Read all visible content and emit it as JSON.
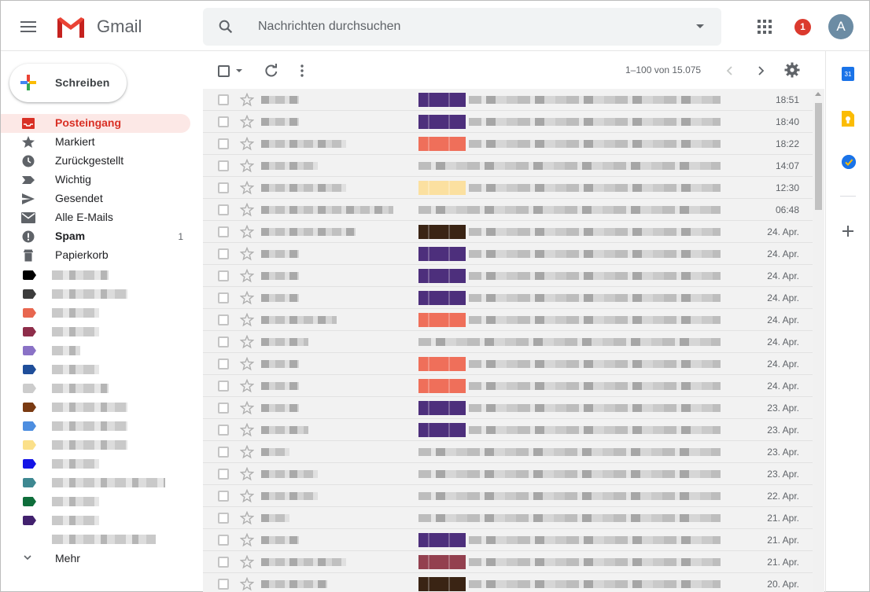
{
  "app": {
    "name": "Gmail"
  },
  "search": {
    "placeholder": "Nachrichten durchsuchen"
  },
  "header": {
    "notification_count": "1",
    "avatar_letter": "A"
  },
  "compose": {
    "label": "Schreiben"
  },
  "sidebar": {
    "items": [
      {
        "label": "Posteingang",
        "icon": "inbox-icon",
        "active": true
      },
      {
        "label": "Markiert",
        "icon": "star-icon"
      },
      {
        "label": "Zurückgestellt",
        "icon": "clock-icon"
      },
      {
        "label": "Wichtig",
        "icon": "important-icon"
      },
      {
        "label": "Gesendet",
        "icon": "send-icon"
      },
      {
        "label": "Alle E-Mails",
        "icon": "mail-icon"
      },
      {
        "label": "Spam",
        "icon": "spam-icon",
        "bold": true,
        "count": "1"
      },
      {
        "label": "Papierkorb",
        "icon": "trash-icon"
      }
    ],
    "label_colors": [
      "#000000",
      "#3c3c3c",
      "#e8664f",
      "#8e2d4a",
      "#8a72c6",
      "#1f4e9a",
      "#cccccc",
      "#7a3a12",
      "#4d8ee0",
      "#fbe08a",
      "#1414e6",
      "#3e8891",
      "#0f6e3b",
      "#42216e",
      "#ffffff"
    ],
    "more_label": "Mehr"
  },
  "toolbar": {
    "pager": "1–100 von 15.075"
  },
  "emails": [
    {
      "date": "18:51",
      "thumb": "#4d2f7c"
    },
    {
      "date": "18:40",
      "thumb": "#4d2f7c"
    },
    {
      "date": "18:22",
      "thumb": "#ef6f5a"
    },
    {
      "date": "14:07",
      "thumb": ""
    },
    {
      "date": "12:30",
      "thumb": "#fbe0a0"
    },
    {
      "date": "06:48",
      "thumb": ""
    },
    {
      "date": "24. Apr.",
      "thumb": "#3a2414"
    },
    {
      "date": "24. Apr.",
      "thumb": "#4d2f7c"
    },
    {
      "date": "24. Apr.",
      "thumb": "#4d2f7c"
    },
    {
      "date": "24. Apr.",
      "thumb": "#4d2f7c"
    },
    {
      "date": "24. Apr.",
      "thumb": "#ef6f5a"
    },
    {
      "date": "24. Apr.",
      "thumb": ""
    },
    {
      "date": "24. Apr.",
      "thumb": "#ef6f5a"
    },
    {
      "date": "24. Apr.",
      "thumb": "#ef6f5a"
    },
    {
      "date": "23. Apr.",
      "thumb": "#4d2f7c"
    },
    {
      "date": "23. Apr.",
      "thumb": "#4d2f7c"
    },
    {
      "date": "23. Apr.",
      "thumb": ""
    },
    {
      "date": "23. Apr.",
      "thumb": ""
    },
    {
      "date": "22. Apr.",
      "thumb": ""
    },
    {
      "date": "21. Apr.",
      "thumb": ""
    },
    {
      "date": "21. Apr.",
      "thumb": "#4d2f7c"
    },
    {
      "date": "21. Apr.",
      "thumb": "#93404f"
    },
    {
      "date": "20. Apr.",
      "thumb": "#3a2414"
    }
  ]
}
